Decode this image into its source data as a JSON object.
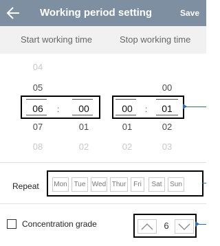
{
  "header": {
    "title": "Working period setting",
    "save_label": "Save",
    "back_icon": "back-arrow-icon"
  },
  "tabs": {
    "start_label": "Start working time",
    "stop_label": "Stop working time"
  },
  "start_picker": {
    "hours": [
      "04",
      "05",
      "06",
      "07",
      "08"
    ],
    "minutes": [
      "",
      "",
      "00",
      "01",
      "02"
    ],
    "selected_hour": "06",
    "selected_minute": "00",
    "separator": ":"
  },
  "stop_picker": {
    "hours": [
      "",
      "",
      "00",
      "01",
      "02"
    ],
    "minutes": [
      "",
      "00",
      "01",
      "02",
      "03"
    ],
    "selected_hour": "00",
    "selected_minute": "01",
    "separator": ":"
  },
  "repeat": {
    "label": "Repeat",
    "days": [
      "Mon",
      "Tue",
      "Wed",
      "Thur",
      "Fri",
      "Sat",
      "Sun"
    ]
  },
  "concentration": {
    "label": "Concentration grade",
    "value": "6",
    "checked": false
  },
  "colors": {
    "header_bg": "#7d8fa0",
    "pointer": "#2a6db3"
  }
}
